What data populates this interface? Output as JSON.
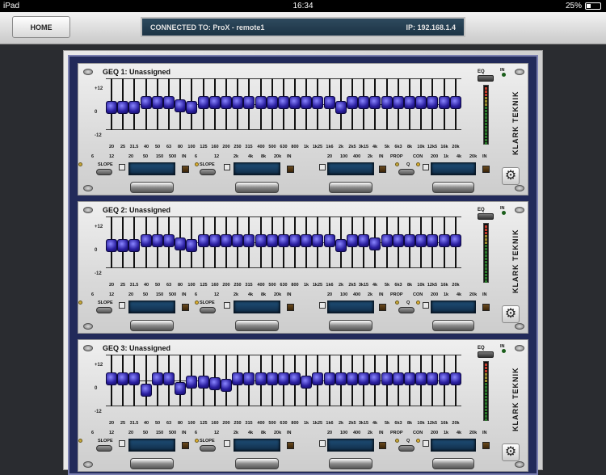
{
  "status": {
    "device": "iPad",
    "time": "16:34",
    "battery": "25%",
    "battery_level": 0.25
  },
  "header": {
    "home_label": "HOME",
    "connected": "CONNECTED TO: ProX - remote1",
    "ip": "IP: 192.168.1.4"
  },
  "labels": {
    "scale_top": "+12",
    "scale_mid": "0",
    "scale_bot": "-12",
    "eq": "EQ",
    "in": "IN",
    "brand": "KLARK TEKNIK",
    "slope": "SLOPE",
    "prop": "PROP",
    "con": "CON",
    "q": "Q",
    "lowcut_a": "6",
    "lowcut_b": "12",
    "hp_a": "20",
    "hp_b": "50",
    "hp_c": "150",
    "hp_d": "500",
    "lp_a": "2k",
    "lp_b": "4k",
    "lp_c": "8k",
    "lp_d": "20k",
    "mf_a": "20",
    "mf_b": "100",
    "mf_c": "400",
    "mf_d": "2k",
    "hf_a": "200",
    "hf_b": "1k",
    "hf_c": "4k",
    "hf_d": "20k"
  },
  "frequencies": [
    "20",
    "25",
    "31.5",
    "40",
    "50",
    "63",
    "80",
    "100",
    "125",
    "160",
    "200",
    "250",
    "315",
    "400",
    "500",
    "630",
    "800",
    "1k",
    "1k25",
    "1k6",
    "2k",
    "2k5",
    "3k15",
    "4k",
    "5k",
    "6k3",
    "8k",
    "10k",
    "12k5",
    "16k",
    "20k"
  ],
  "units": [
    {
      "title": "GEQ 1: Unassigned",
      "gains": [
        -2,
        -2,
        -2,
        1,
        1,
        1,
        -1,
        -2,
        1,
        1,
        1,
        1,
        1,
        1,
        1,
        1,
        1,
        1,
        1,
        1,
        -2,
        1,
        1,
        1,
        1,
        1,
        1,
        1,
        1,
        1,
        1
      ]
    },
    {
      "title": "GEQ 2: Unassigned",
      "gains": [
        -2,
        -2,
        -2,
        1,
        1,
        1,
        -1,
        -2,
        1,
        1,
        1,
        1,
        1,
        1,
        1,
        1,
        1,
        1,
        1,
        1,
        -2,
        1,
        1,
        -1,
        1,
        1,
        1,
        1,
        1,
        1,
        1
      ]
    },
    {
      "title": "GEQ 3: Unassigned",
      "gains": [
        1,
        1,
        1,
        -6,
        1,
        1,
        -5,
        -1,
        -1,
        -2,
        -3,
        1,
        1,
        1,
        1,
        1,
        1,
        -1,
        1,
        1,
        1,
        1,
        1,
        1,
        1,
        1,
        1,
        1,
        1,
        1,
        1
      ]
    }
  ],
  "colors": {
    "knob": "#3a2fd0",
    "display": "#1f4f78",
    "frame": "#222a5a"
  }
}
